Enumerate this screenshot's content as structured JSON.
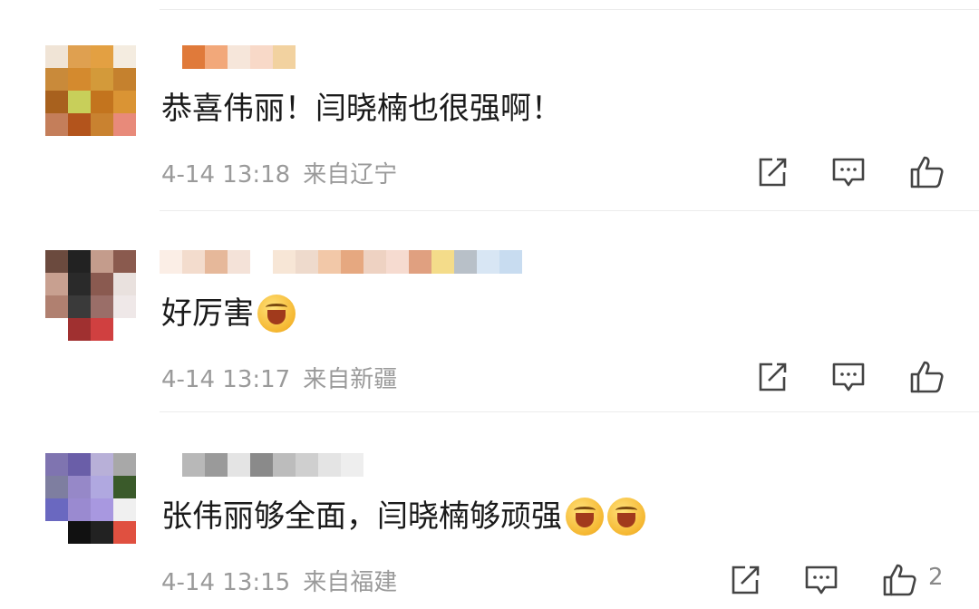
{
  "comments": [
    {
      "text": "恭喜伟丽！闫晓楠也很强啊！",
      "emojis": [],
      "date": "4-14 13:18",
      "location": "来自辽宁",
      "likes": "",
      "avatar_colors": [
        "#f0e4d6",
        "#dfa050",
        "#e3a042",
        "#f4ece0",
        "#c98a3a",
        "#d48a2e",
        "#d39a3a",
        "#c5812e",
        "#a8611e",
        "#c8cf5a",
        "#c3741e",
        "#da9434",
        "#c47e5a",
        "#b3541c",
        "#c98230",
        "#e88a7a"
      ],
      "nick_colors": [
        "#ffffff",
        "#e07a3a",
        "#f2a87a",
        "#f6e6da",
        "#f8d9c8",
        "#f2d2a0"
      ]
    },
    {
      "text": "好厉害",
      "emojis": [
        "flower-smile-emoji"
      ],
      "date": "4-14 13:17",
      "location": "来自新疆",
      "likes": "",
      "avatar_colors": [
        "#6b4a3e",
        "#222222",
        "#c49c8c",
        "#8a5a4e",
        "#c8a090",
        "#2a2a2a",
        "#8a5a50",
        "#e9e1de",
        "#b08070",
        "#3a3a3a",
        "#9a6e68",
        "#efe8e8",
        "#ffffff",
        "#a03030",
        "#d04040",
        "#ffffff"
      ],
      "nick_colors": [
        "#fbeee6",
        "#f3dccd",
        "#e6b89a",
        "#f4e2d8",
        "#ffffff",
        "#f7e6d6",
        "#eedacc",
        "#f2c8a8",
        "#e6a880",
        "#eed2c2",
        "#f6dbd0",
        "#e0a080",
        "#f4dc8a",
        "#b8c0c8",
        "#d8e6f4",
        "#c8dcf0"
      ]
    },
    {
      "text": "张伟丽够全面，闫晓楠够顽强",
      "emojis": [
        "laugh-cry-emoji",
        "laugh-cry-emoji"
      ],
      "date": "4-14 13:15",
      "location": "来自福建",
      "likes": "2",
      "avatar_colors": [
        "#7f74b0",
        "#6a5ea8",
        "#b8b0d8",
        "#a8a8a8",
        "#7e7ea0",
        "#9688c8",
        "#b0a8e0",
        "#3a5a2a",
        "#6a68c0",
        "#9a8ad0",
        "#a898e0",
        "#f0f0f0",
        "#ffffff",
        "#111111",
        "#222222",
        "#e05040"
      ],
      "nick_colors": [
        "#ffffff",
        "#b8b8b8",
        "#9a9a9a",
        "#e4e4e4",
        "#8a8a8a",
        "#bcbcbc",
        "#cfcfcf",
        "#e4e4e4",
        "#eeeeee"
      ]
    }
  ],
  "icons": {
    "share": "share-icon",
    "comment": "comment-icon",
    "like": "thumbs-up-icon"
  }
}
